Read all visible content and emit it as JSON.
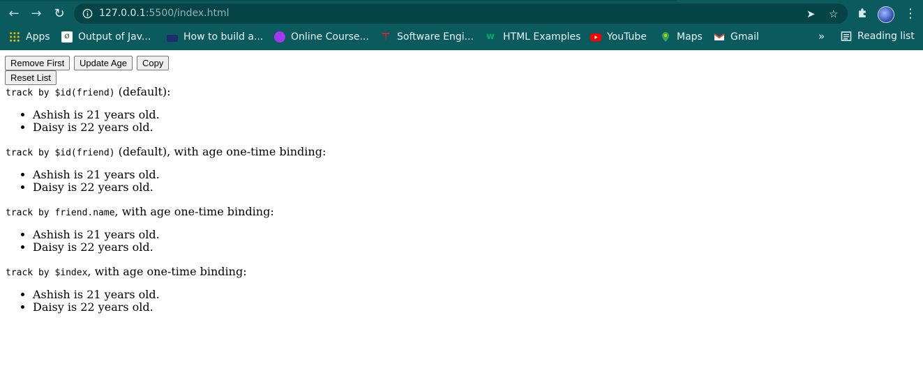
{
  "browser": {
    "url_host": "127.0.0.1",
    "url_path": ":5500/index.html",
    "bookmarks": [
      {
        "label": "Apps",
        "icon": "apps-grid-icon"
      },
      {
        "label": "Output of Jav...",
        "icon": "output-icon"
      },
      {
        "label": "How to build a...",
        "icon": "ipro-icon"
      },
      {
        "label": "Online Course...",
        "icon": "udemy-icon"
      },
      {
        "label": "Software Engi...",
        "icon": "tesla-icon"
      },
      {
        "label": "HTML Examples",
        "icon": "w3-icon"
      },
      {
        "label": "YouTube",
        "icon": "youtube-icon"
      },
      {
        "label": "Maps",
        "icon": "maps-icon"
      },
      {
        "label": "Gmail",
        "icon": "gmail-icon"
      }
    ],
    "overflow_label": "»",
    "reading_list_label": "Reading list"
  },
  "buttons": {
    "remove_first": "Remove First",
    "update_age": "Update Age",
    "copy": "Copy",
    "reset_list": "Reset List"
  },
  "sections": [
    {
      "code": "track by $id(friend)",
      "suffix": " (default):",
      "items": [
        "Ashish is 21 years old.",
        "Daisy is 22 years old."
      ]
    },
    {
      "code": "track by $id(friend)",
      "suffix": " (default), with age one-time binding:",
      "items": [
        "Ashish is 21 years old.",
        "Daisy is 22 years old."
      ]
    },
    {
      "code": "track by friend.name",
      "suffix": ", with age one-time binding:",
      "items": [
        "Ashish is 21 years old.",
        "Daisy is 22 years old."
      ]
    },
    {
      "code": "track by $index",
      "suffix": ", with age one-time binding:",
      "items": [
        "Ashish is 21 years old.",
        "Daisy is 22 years old."
      ]
    }
  ],
  "colors": {
    "toolbar": "#0b5b5e",
    "omnibox": "#074447"
  }
}
